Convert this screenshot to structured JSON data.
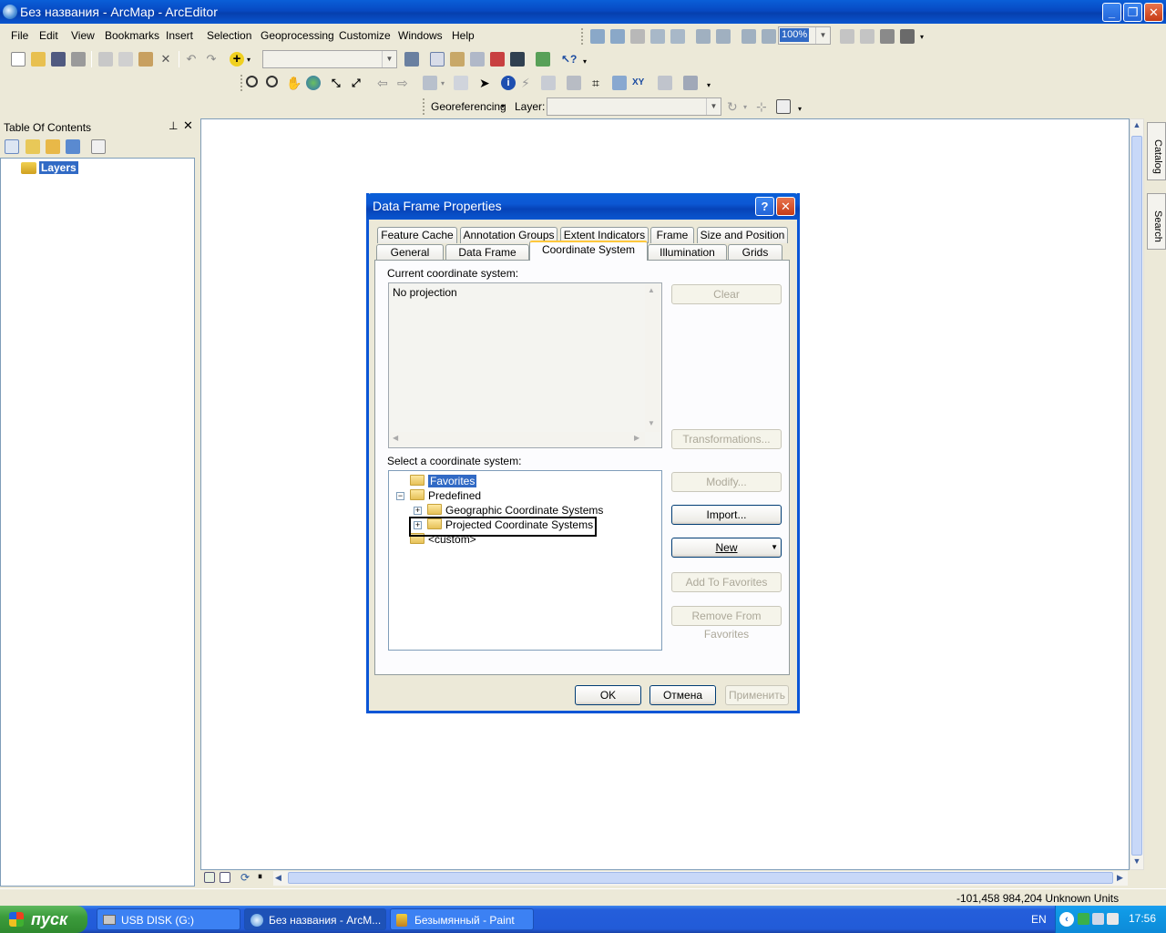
{
  "window": {
    "title": "Без названия - ArcMap - ArcEditor"
  },
  "menu": [
    "File",
    "Edit",
    "View",
    "Bookmarks",
    "Insert",
    "Selection",
    "Geoprocessing",
    "Customize",
    "Windows",
    "Help"
  ],
  "toolbar": {
    "zoom_value": "100%",
    "georef_label": "Georeferencing",
    "layer_label": "Layer:"
  },
  "toc": {
    "title": "Table Of Contents",
    "root_label": "Layers"
  },
  "side_tabs": {
    "catalog": "Catalog",
    "search": "Search"
  },
  "dialog": {
    "title": "Data Frame Properties",
    "tabs_row1": [
      "Feature Cache",
      "Annotation Groups",
      "Extent Indicators",
      "Frame",
      "Size and Position"
    ],
    "tabs_row2": [
      "General",
      "Data Frame",
      "Coordinate System",
      "Illumination",
      "Grids"
    ],
    "current_label": "Current coordinate system:",
    "current_value": "No projection",
    "clear_btn": "Clear",
    "transformations_btn": "Transformations...",
    "select_label": "Select a coordinate system:",
    "tree": {
      "favorites": "Favorites",
      "predefined": "Predefined",
      "geographic": "Geographic Coordinate Systems",
      "projected": "Projected Coordinate Systems",
      "custom": "<custom>"
    },
    "modify_btn": "Modify...",
    "import_btn": "Import...",
    "new_btn": "New",
    "add_fav_btn": "Add To Favorites",
    "remove_fav_btn": "Remove From Favorites",
    "ok_btn": "OK",
    "cancel_btn": "Отмена",
    "apply_btn": "Применить"
  },
  "status": {
    "coords": "-101,458  984,204 Unknown Units"
  },
  "taskbar": {
    "start": "пуск",
    "tasks": [
      "USB DISK (G:)",
      "Без названия - ArcM...",
      "Безымянный - Paint"
    ],
    "lang": "EN",
    "clock": "17:56"
  }
}
